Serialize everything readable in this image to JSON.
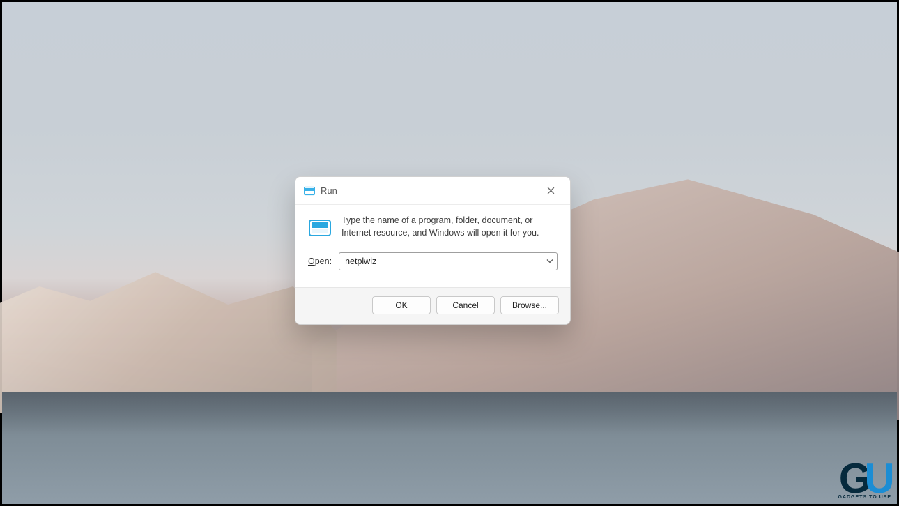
{
  "dialog": {
    "title": "Run",
    "description": "Type the name of a program, folder, document, or Internet resource, and Windows will open it for you.",
    "open_label_prefix": "O",
    "open_label_rest": "pen:",
    "input_value": "netplwiz",
    "buttons": {
      "ok": "OK",
      "cancel": "Cancel",
      "browse_prefix": "B",
      "browse_rest": "rowse..."
    }
  },
  "watermark": {
    "g": "G",
    "u": "U",
    "tag": "GADGETS TO USE"
  }
}
